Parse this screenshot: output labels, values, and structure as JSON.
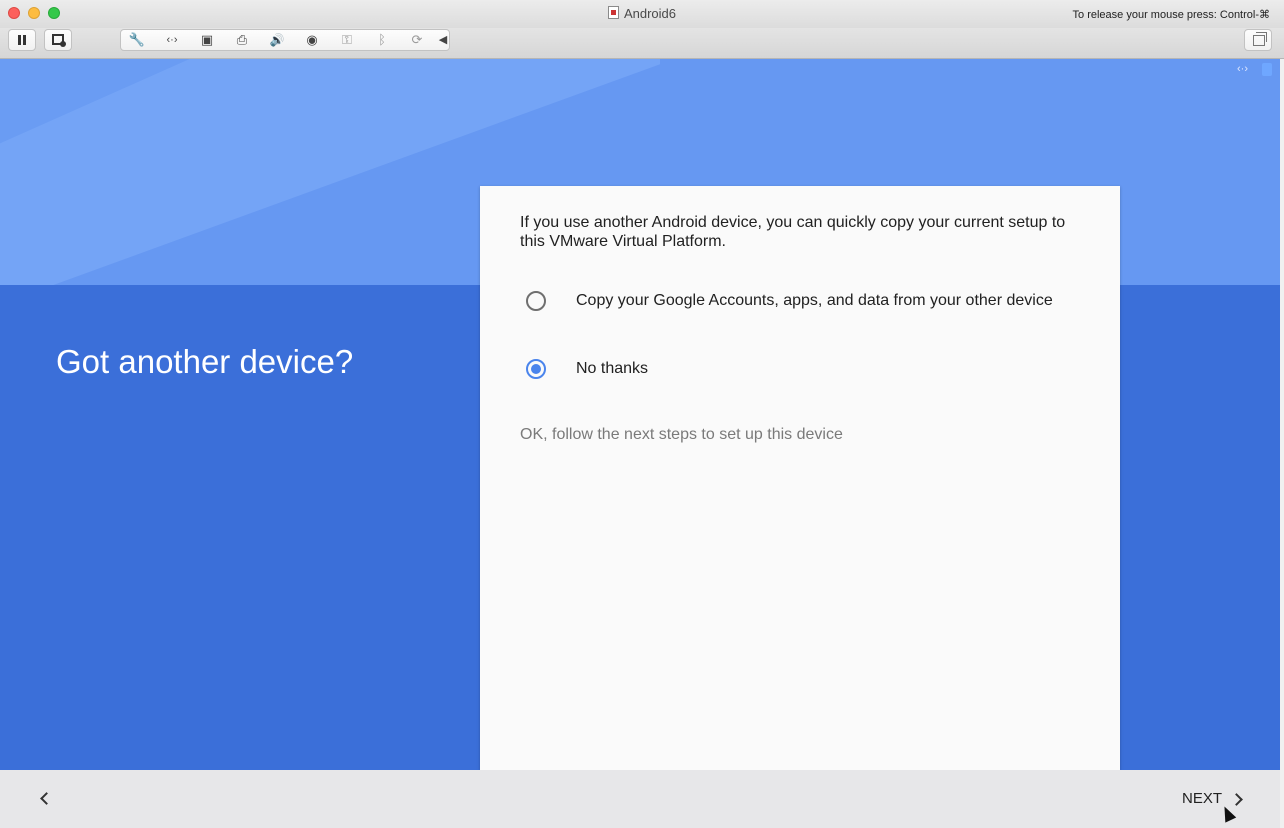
{
  "window": {
    "title": "Android6",
    "release_hint": "To release your mouse press: Control-⌘"
  },
  "toolbar": {
    "icons": [
      "pause-icon",
      "snapshot-icon",
      "wrench-icon",
      "network-icon",
      "disk-icon",
      "printer-icon",
      "sound-icon",
      "camera-icon",
      "usb-icon",
      "bluetooth-icon",
      "sync-icon",
      "collapse-icon",
      "restore-icon"
    ],
    "wrench_glyph": "🔧",
    "network_glyph": "‹·›",
    "disk_glyph": "▣",
    "printer_glyph": "⎙",
    "sound_glyph": "🔊",
    "camera_glyph": "◉",
    "usb_glyph": "⚿",
    "bluetooth_glyph": "ᛒ",
    "sync_glyph": "⟳",
    "collapse_glyph": "◀"
  },
  "tray": {
    "network_glyph": "‹·›"
  },
  "setup": {
    "heading": "Got another device?",
    "intro": "If you use another Android device, you can quickly copy your current setup to this VMware Virtual Platform.",
    "options": [
      {
        "label": "Copy your Google Accounts, apps, and data from your other device",
        "selected": false
      },
      {
        "label": "No thanks",
        "selected": true
      }
    ],
    "helper": "OK, follow the next steps to set up this device",
    "accent_color": "#4a84ec"
  },
  "nav": {
    "next_label": "NEXT"
  }
}
